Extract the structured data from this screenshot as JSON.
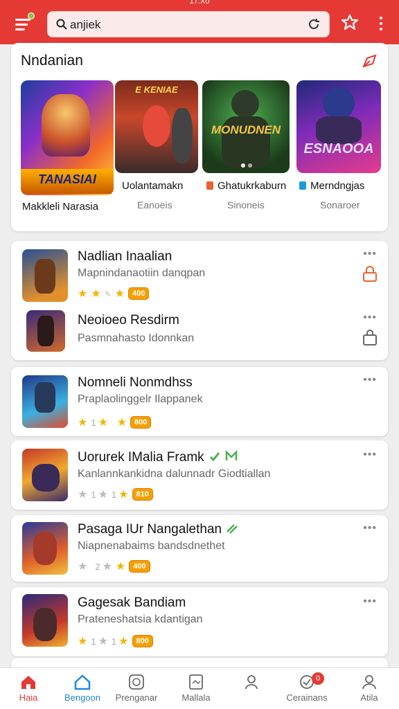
{
  "status_bar": {
    "text": "17:X0"
  },
  "header": {
    "search_value": "anjiek"
  },
  "featured": {
    "title": "Nndanian",
    "items": [
      {
        "image_text": "TANASIAI",
        "name": "Makkleli Narasia",
        "sub": ""
      },
      {
        "image_text": "E KENIAE",
        "name": "Uolantamakn",
        "sub": "Eanoeis"
      },
      {
        "image_text": "MONUDNEN",
        "name": "Ghatukrkaburn",
        "sub": "Sinoneis",
        "badge_color": "#e8632c"
      },
      {
        "image_text": "ESNAOOA",
        "name": "Merndngjas",
        "sub": "Sonaroer",
        "badge_color": "#1e9ad6"
      }
    ]
  },
  "apps": [
    {
      "name": "Nadlian Inaalian",
      "desc": "Mapnindanaotiin danqpan",
      "stars": [
        1,
        1,
        0,
        1
      ],
      "badge": "400",
      "side": "lock"
    },
    {
      "name": "Neoioeo Resdirm",
      "desc": "Pasmnahasto Idonnkan",
      "side": "bag"
    },
    {
      "name": "Nomneli Nonmdhss",
      "desc": "Praplaolinggelr Ilappanek",
      "stars": [
        1,
        1,
        0,
        1
      ],
      "nums": [
        "1",
        "1",
        ""
      ],
      "badge": "800"
    },
    {
      "name": "Uorurek IMalia Framk",
      "desc": "Kanlannkankidna dalunnadr Giodtiallan",
      "stars": [
        0,
        0,
        0,
        1
      ],
      "nums": [
        "1",
        "1",
        ""
      ],
      "badge": "810",
      "verified": true
    },
    {
      "name": "Pasaga IUr Nangalethan",
      "desc": "Niapnenabaims bandsdnethet",
      "stars": [
        0,
        0,
        0,
        1
      ],
      "nums": [
        "",
        "2",
        ""
      ],
      "badge": "400",
      "verified": true
    },
    {
      "name": "Gagesak Bandiam",
      "desc": "Prateneshatsia kdantigan",
      "stars": [
        1,
        0,
        0,
        1
      ],
      "nums": [
        "1",
        "1",
        ""
      ],
      "badge": "800"
    }
  ],
  "nav": [
    {
      "label": "Haia",
      "icon": "home-icon",
      "active": true
    },
    {
      "label": "Bengoon",
      "icon": "house-outline-icon"
    },
    {
      "label": "Prenganar",
      "icon": "gamepad-icon"
    },
    {
      "label": "Mallala",
      "icon": "document-icon"
    },
    {
      "label": "",
      "icon": "user-icon"
    },
    {
      "label": "Cerainans",
      "icon": "check-icon",
      "badge": "0"
    },
    {
      "label": "Atila",
      "icon": "person-icon"
    }
  ],
  "colors": {
    "primary": "#e53935",
    "accent_star": "#f5b400",
    "badge": "#f5a000"
  }
}
